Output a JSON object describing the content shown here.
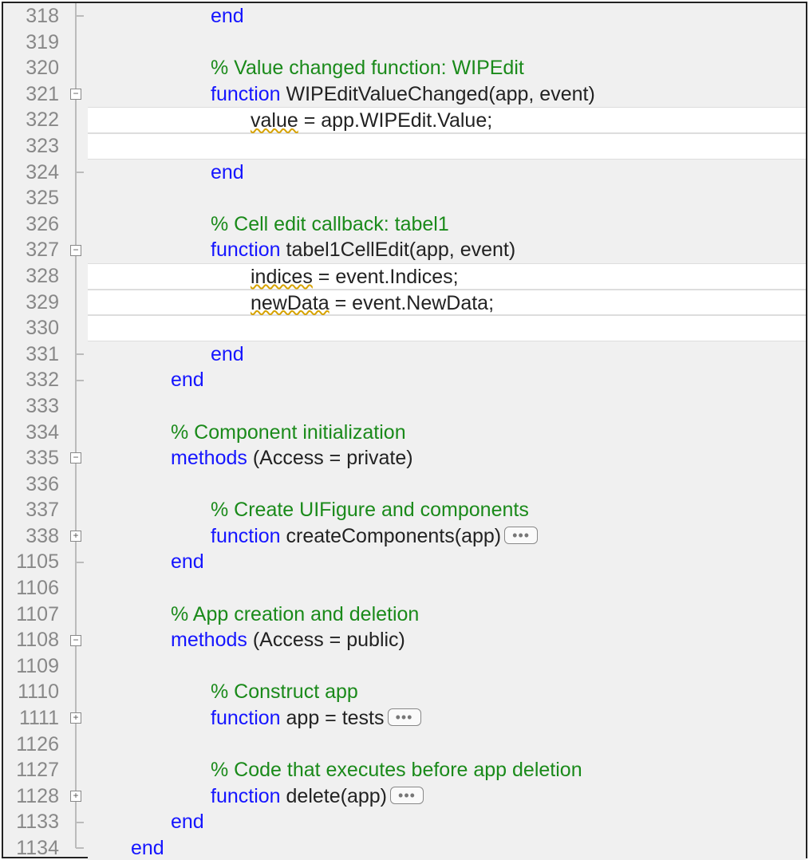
{
  "colors": {
    "keyword": "#1515ff",
    "comment": "#1a8a1a",
    "gutter": "#888888",
    "editableBg": "#ffffff",
    "readonlyBg": "#f0f0f0"
  },
  "lines": [
    {
      "n": "318",
      "fold": "line+end",
      "bg": "gray",
      "indent": 3,
      "tokens": [
        [
          "end",
          "kw"
        ]
      ]
    },
    {
      "n": "319",
      "fold": "line",
      "bg": "gray",
      "indent": 0,
      "tokens": []
    },
    {
      "n": "320",
      "fold": "line",
      "bg": "gray",
      "indent": 3,
      "tokens": [
        [
          "% Value changed function: WIPEdit",
          "comment"
        ]
      ]
    },
    {
      "n": "321",
      "fold": "minus",
      "bg": "gray",
      "indent": 3,
      "tokens": [
        [
          "function",
          "kw"
        ],
        [
          " WIPEditValueChanged(app, event)",
          "plain"
        ]
      ]
    },
    {
      "n": "322",
      "fold": "line",
      "bg": "white",
      "indent": 4,
      "tokens": [
        [
          "value",
          "warn"
        ],
        [
          " = app.WIPEdit.Value;",
          "plain"
        ]
      ]
    },
    {
      "n": "323",
      "fold": "line",
      "bg": "white",
      "indent": 0,
      "tokens": []
    },
    {
      "n": "324",
      "fold": "line+end",
      "bg": "gray",
      "indent": 3,
      "tokens": [
        [
          "end",
          "kw"
        ]
      ]
    },
    {
      "n": "325",
      "fold": "line",
      "bg": "gray",
      "indent": 0,
      "tokens": []
    },
    {
      "n": "326",
      "fold": "line",
      "bg": "gray",
      "indent": 3,
      "tokens": [
        [
          "% Cell edit callback: tabel1",
          "comment"
        ]
      ]
    },
    {
      "n": "327",
      "fold": "minus",
      "bg": "gray",
      "indent": 3,
      "tokens": [
        [
          "function",
          "kw"
        ],
        [
          " tabel1CellEdit(app, event)",
          "plain"
        ]
      ]
    },
    {
      "n": "328",
      "fold": "line",
      "bg": "white",
      "indent": 4,
      "tokens": [
        [
          "indices",
          "warn"
        ],
        [
          " = event.Indices;",
          "plain"
        ]
      ]
    },
    {
      "n": "329",
      "fold": "line",
      "bg": "white",
      "indent": 4,
      "tokens": [
        [
          "newData",
          "warn"
        ],
        [
          " = event.NewData;",
          "plain"
        ]
      ]
    },
    {
      "n": "330",
      "fold": "line",
      "bg": "white",
      "indent": 0,
      "tokens": []
    },
    {
      "n": "331",
      "fold": "line+end",
      "bg": "gray",
      "indent": 3,
      "tokens": [
        [
          "end",
          "kw"
        ]
      ]
    },
    {
      "n": "332",
      "fold": "line+end",
      "bg": "gray",
      "indent": 2,
      "tokens": [
        [
          "end",
          "kw"
        ]
      ]
    },
    {
      "n": "333",
      "fold": "line",
      "bg": "gray",
      "indent": 0,
      "tokens": []
    },
    {
      "n": "334",
      "fold": "line",
      "bg": "gray",
      "indent": 2,
      "tokens": [
        [
          "% Component initialization",
          "comment"
        ]
      ]
    },
    {
      "n": "335",
      "fold": "minus",
      "bg": "gray",
      "indent": 2,
      "tokens": [
        [
          "methods",
          "kw"
        ],
        [
          " (Access = private)",
          "plain"
        ]
      ]
    },
    {
      "n": "336",
      "fold": "line",
      "bg": "gray",
      "indent": 0,
      "tokens": []
    },
    {
      "n": "337",
      "fold": "line",
      "bg": "gray",
      "indent": 3,
      "tokens": [
        [
          "% Create UIFigure and components",
          "comment"
        ]
      ]
    },
    {
      "n": "338",
      "fold": "plus",
      "bg": "gray",
      "indent": 3,
      "tokens": [
        [
          "function",
          "kw"
        ],
        [
          " createComponents(app)",
          "plain"
        ]
      ],
      "ellipsis": true
    },
    {
      "n": "1105",
      "fold": "line+end",
      "bg": "gray",
      "indent": 2,
      "tokens": [
        [
          "end",
          "kw"
        ]
      ]
    },
    {
      "n": "1106",
      "fold": "line",
      "bg": "gray",
      "indent": 0,
      "tokens": []
    },
    {
      "n": "1107",
      "fold": "line",
      "bg": "gray",
      "indent": 2,
      "tokens": [
        [
          "% App creation and deletion",
          "comment"
        ]
      ]
    },
    {
      "n": "1108",
      "fold": "minus",
      "bg": "gray",
      "indent": 2,
      "tokens": [
        [
          "methods",
          "kw"
        ],
        [
          " (Access = public)",
          "plain"
        ]
      ]
    },
    {
      "n": "1109",
      "fold": "line",
      "bg": "gray",
      "indent": 0,
      "tokens": []
    },
    {
      "n": "1110",
      "fold": "line",
      "bg": "gray",
      "indent": 3,
      "tokens": [
        [
          "% Construct app",
          "comment"
        ]
      ]
    },
    {
      "n": "1111",
      "fold": "plus",
      "bg": "gray",
      "indent": 3,
      "tokens": [
        [
          "function",
          "kw"
        ],
        [
          " app = tests",
          "plain"
        ]
      ],
      "ellipsis": true
    },
    {
      "n": "1126",
      "fold": "line",
      "bg": "gray",
      "indent": 0,
      "tokens": []
    },
    {
      "n": "1127",
      "fold": "line",
      "bg": "gray",
      "indent": 3,
      "tokens": [
        [
          "% Code that executes before app deletion",
          "comment"
        ]
      ]
    },
    {
      "n": "1128",
      "fold": "plus",
      "bg": "gray",
      "indent": 3,
      "tokens": [
        [
          "function",
          "kw"
        ],
        [
          " delete(app)",
          "plain"
        ]
      ],
      "ellipsis": true
    },
    {
      "n": "1133",
      "fold": "line+end",
      "bg": "gray",
      "indent": 2,
      "tokens": [
        [
          "end",
          "kw"
        ]
      ]
    },
    {
      "n": "1134",
      "fold": "end",
      "bg": "gray",
      "indent": 1,
      "tokens": [
        [
          "end",
          "kw"
        ]
      ]
    }
  ],
  "labels": {
    "ellipsis": "•••"
  }
}
